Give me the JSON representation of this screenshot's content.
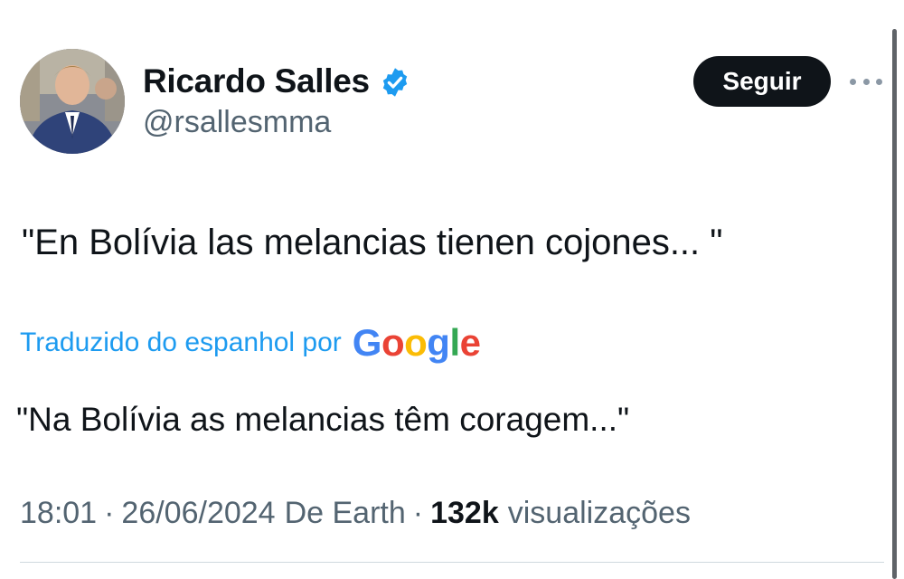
{
  "author": {
    "display_name": "Ricardo Salles",
    "handle": "@rsallesmma",
    "verified_icon": "verified-badge-icon",
    "verified_color": "#1d9bf0"
  },
  "actions": {
    "follow_label": "Seguir",
    "more_icon": "more-options-icon"
  },
  "tweet": {
    "text": "\"En Bolívia las melancias tienen cojones... \""
  },
  "translation": {
    "label": "Traduzido do espanhol por",
    "provider_logo": [
      "G",
      "o",
      "o",
      "g",
      "l",
      "e"
    ],
    "provider_colors": [
      "#4285f4",
      "#ea4335",
      "#fbbc05",
      "#4285f4",
      "#34a853",
      "#ea4335"
    ],
    "text": "\"Na Bolívia as melancias têm coragem...\""
  },
  "meta": {
    "time": "18:01",
    "separator": "·",
    "date": "26/06/2024",
    "source": "De Earth",
    "views_count": "132k",
    "views_label": "visualizações"
  },
  "colors": {
    "text_primary": "#0f1419",
    "text_secondary": "#536471",
    "link": "#1d9bf0",
    "button_bg": "#0f1419"
  }
}
